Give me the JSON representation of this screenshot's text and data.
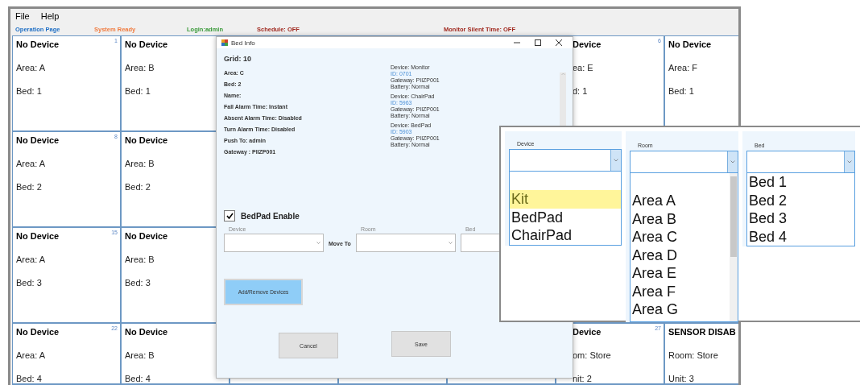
{
  "menu": [
    "File",
    "Help"
  ],
  "status": [
    {
      "text": "Operation Page",
      "color": "#1f6fc5"
    },
    {
      "text": "System Ready",
      "color": "#f07b3f"
    },
    {
      "text": "Login:admin",
      "color": "#3a9a3a"
    },
    {
      "text": "Schedule: OFF",
      "color": "#a0281e"
    },
    {
      "text": "Monitor Silent Time: OFF",
      "color": "#a0281e"
    }
  ],
  "grid": {
    "rows": [
      {
        "cells": [
          {
            "title": "No Device",
            "number": "1",
            "line_1": "Area: A",
            "line_2": "Bed: 1"
          },
          {
            "title": "No Device",
            "line_1": "Area: B",
            "line_2": "Bed: 1"
          },
          {},
          {},
          {},
          {
            "kind": "clipped",
            "title": "Device",
            "number": "6",
            "line_1": "ea: E",
            "line_2": "d: 1"
          },
          {
            "title": "No Device",
            "line_1": "Area: F",
            "line_2": "Bed: 1"
          }
        ]
      },
      {
        "cells": [
          {
            "title": "No Device",
            "number": "8",
            "line_1": "Area: A",
            "line_2": "Bed: 2"
          },
          {
            "title": "No Device",
            "line_1": "Area: B",
            "line_2": "Bed: 2"
          },
          {},
          {},
          {},
          {},
          {}
        ]
      },
      {
        "cells": [
          {
            "title": "No Device",
            "number": "15",
            "line_1": "Area: A",
            "line_2": "Bed: 3"
          },
          {
            "title": "No Device",
            "line_1": "Area: B",
            "line_2": "Bed: 3"
          },
          {},
          {},
          {},
          {},
          {}
        ]
      },
      {
        "cells": [
          {
            "title": "No Device",
            "number": "22",
            "line_1": "Area: A",
            "line_2": "Bed: 4"
          },
          {
            "title": "No Device",
            "line_1": "Area: B",
            "line_2": "Bed: 4"
          },
          {},
          {},
          {},
          {
            "kind": "clipped",
            "title": "Device",
            "number": "27",
            "line_1": "om: Store",
            "line_2": "nit: 2"
          },
          {
            "title": "SENSOR DISAB",
            "line_1": "Room: Store",
            "line_2": "Unit: 3"
          }
        ]
      }
    ]
  },
  "dialog": {
    "title": "Bed Info",
    "heading": "Grid: 10",
    "info": [
      "Area: C",
      "Bed: 2",
      "Name:",
      "Fall Alarm Time: Instant",
      "Absent Alarm Time: Disabled",
      "Turn Alarm Time: Disabled",
      "Push To: admin",
      "Gateway : PIIZP001"
    ],
    "devices": [
      {
        "device": "Device: Monitor",
        "id": "ID: 0701",
        "gateway": "Gateway: PIIZP001",
        "battery": "Battery: Normal"
      },
      {
        "device": "Device: ChairPad",
        "id": "ID: 5963",
        "gateway": "Gateway: PIIZP001",
        "battery": "Battery: Normal"
      },
      {
        "device": "Device: BedPad",
        "id": "ID: 5903",
        "gateway": "Gateway: PIIZP001",
        "battery": "Battery: Normal"
      }
    ],
    "checkbox": {
      "label": "BedPad Enable",
      "checked": true
    },
    "fields": [
      "Device",
      "Room",
      "Bed"
    ],
    "move_label": "Move To",
    "add_remove": "Add/Remove Devices",
    "cancel": "Cancel",
    "save": "Save"
  },
  "dropdowns": [
    {
      "label": "Device",
      "options": [
        {
          "text": "Kit",
          "selected": true
        },
        {
          "text": "BedPad",
          "selected": false
        },
        {
          "text": "ChairPad",
          "selected": false
        }
      ],
      "blank_first": true
    },
    {
      "label": "Room",
      "options": [
        {
          "text": "Area A",
          "selected": false
        },
        {
          "text": "Area B",
          "selected": false
        },
        {
          "text": "Area C",
          "selected": false
        },
        {
          "text": "Area D",
          "selected": false
        },
        {
          "text": "Area E",
          "selected": false
        },
        {
          "text": "Area F",
          "selected": false
        },
        {
          "text": "Area G",
          "selected": false
        }
      ],
      "blank_first": true,
      "scrollbar": true
    },
    {
      "label": "Bed",
      "options": [
        {
          "text": "Bed 1",
          "selected": false
        },
        {
          "text": "Bed 2",
          "selected": false
        },
        {
          "text": "Bed 3",
          "selected": false
        },
        {
          "text": "Bed 4",
          "selected": false
        }
      ],
      "blank_first": false
    }
  ]
}
